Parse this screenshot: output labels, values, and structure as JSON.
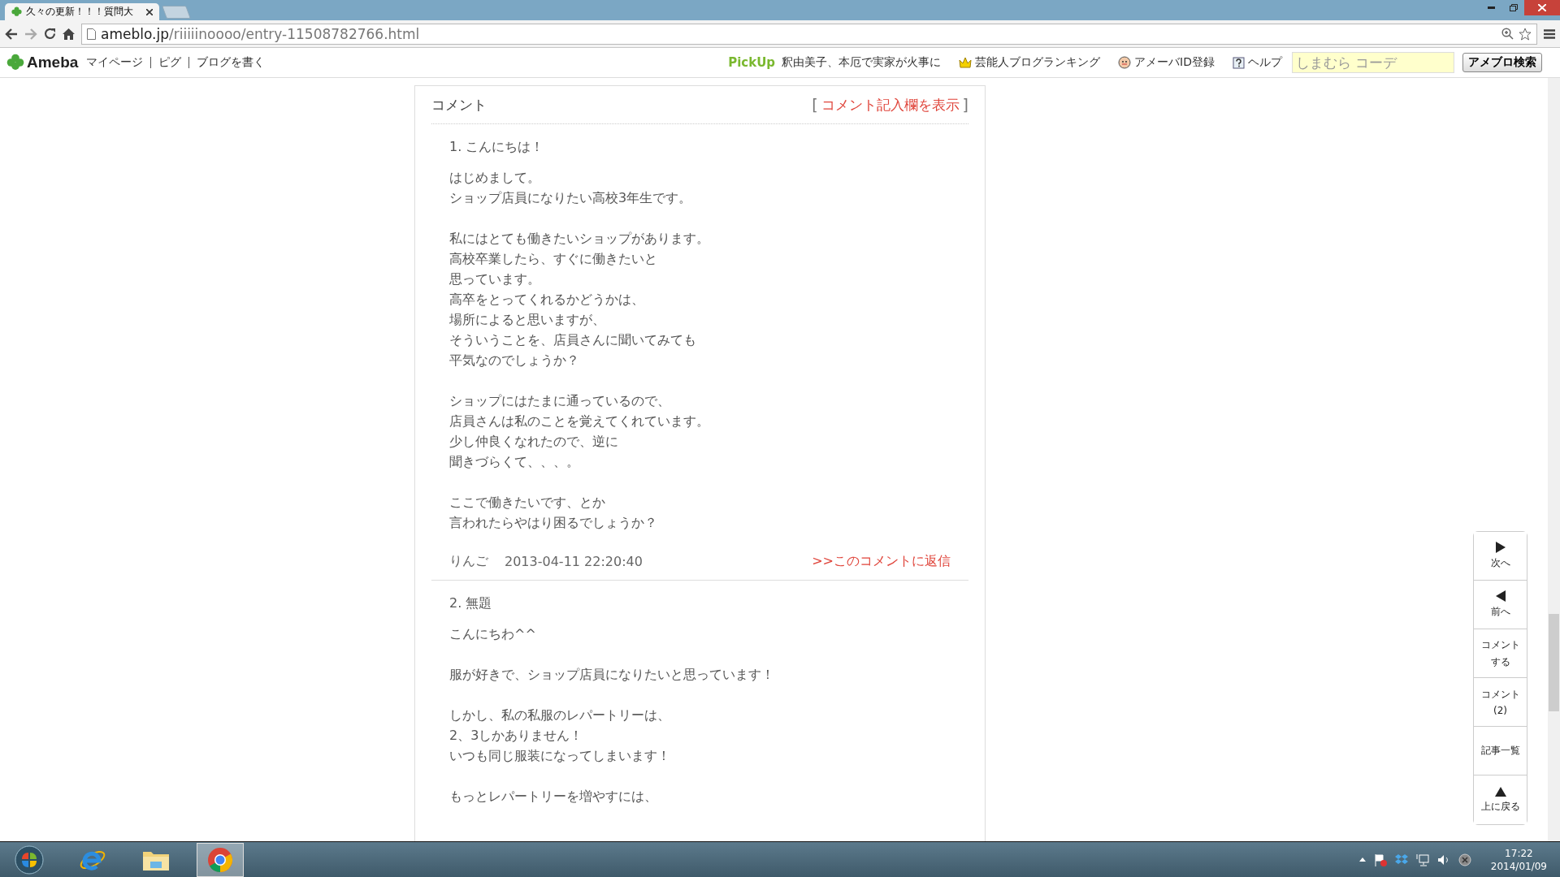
{
  "browser": {
    "tab_title": "久々の更新！！！質問大",
    "address": {
      "domain": "ameblo.jp",
      "path": "/riiiiinoooo/entry-11508782766.html"
    }
  },
  "header": {
    "logo": "Ameba",
    "nav": [
      "マイページ",
      "ピグ",
      "ブログを書く"
    ],
    "pickup": {
      "label": "PickUp",
      "text": "釈由美子、本厄で実家が火事に"
    },
    "links": [
      {
        "kind": "crown",
        "label": "芸能人ブログランキング"
      },
      {
        "kind": "face",
        "label": "アメーバID登録"
      },
      {
        "kind": "help",
        "label": "ヘルプ"
      }
    ],
    "search": {
      "placeholder": "しまむら コーデ"
    },
    "search_button": "アメブロ検索"
  },
  "comments": {
    "title": "コメント",
    "toggle": {
      "open": "[",
      "label": "コメント記入欄を表示",
      "close": "]"
    },
    "items": [
      {
        "title": "1. こんにちは！",
        "paragraphs": [
          [
            "はじめまして。",
            "ショップ店員になりたい高校3年生です。"
          ],
          [
            "私にはとても働きたいショップがあります。",
            "高校卒業したら、すぐに働きたいと",
            "思っています。",
            "高卒をとってくれるかどうかは、",
            "場所によると思いますが、",
            "そういうことを、店員さんに聞いてみても",
            "平気なのでしょうか？"
          ],
          [
            "ショップにはたまに通っているので、",
            "店員さんは私のことを覚えてくれています。",
            "少し仲良くなれたので、逆に",
            "聞きづらくて、、、。"
          ],
          [
            "ここで働きたいです、とか",
            "言われたらやはり困るでしょうか？"
          ]
        ],
        "author": "りんご",
        "date": "2013-04-11 22:20:40",
        "reply": ">>このコメントに返信"
      },
      {
        "title": "2. 無題",
        "paragraphs": [
          [
            "こんにちわ^^"
          ],
          [
            "服が好きで、ショップ店員になりたいと思っています！"
          ],
          [
            "しかし、私の私服のレパートリーは、",
            "2、3しかありません！",
            "いつも同じ服装になってしまいます！"
          ],
          [
            "もっとレパートリーを増やすには、"
          ]
        ]
      }
    ]
  },
  "side_nav": [
    {
      "kind": "next",
      "lines": [
        "次へ"
      ]
    },
    {
      "kind": "prev",
      "lines": [
        "前へ"
      ]
    },
    {
      "kind": "text",
      "lines": [
        "コメント",
        "する"
      ]
    },
    {
      "kind": "text",
      "lines": [
        "コメント",
        "(2)"
      ]
    },
    {
      "kind": "text",
      "lines": [
        "記事一覧"
      ]
    },
    {
      "kind": "up",
      "lines": [
        "上に戻る"
      ]
    }
  ],
  "taskbar": {
    "time": "17:22",
    "date": "2014/01/09"
  }
}
